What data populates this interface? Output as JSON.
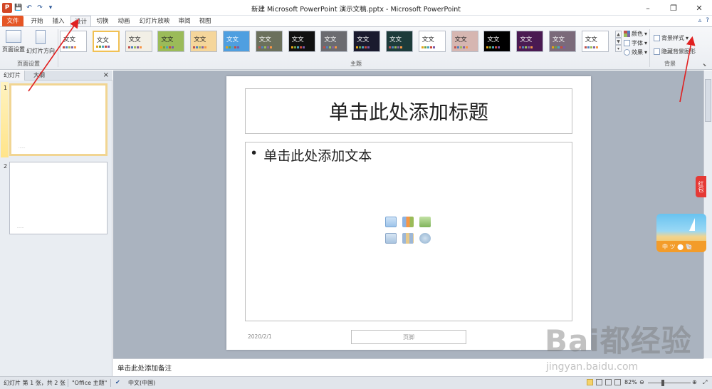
{
  "window": {
    "title": "新建 Microsoft PowerPoint 演示文稿.pptx - Microsoft PowerPoint",
    "app_letter": "P"
  },
  "tabs": [
    "文件",
    "开始",
    "插入",
    "设计",
    "切换",
    "动画",
    "幻灯片放映",
    "审阅",
    "视图"
  ],
  "active_tab": "设计",
  "ribbon": {
    "page_setup": {
      "btn1": "页面设置",
      "btn2": "幻灯片方向",
      "label": "页面设置"
    },
    "themes_label": "主题",
    "theme_sample_text": "文文",
    "theme_text_2": "文文",
    "theme_colors": [
      "#ffffff",
      "#ffffff",
      "#f2efe6",
      "#9bbb59",
      "#f5d69b",
      "#4f9fe0",
      "#6b705c",
      "#111111",
      "#6b6b70",
      "#1a1a2e",
      "#1d3b3a",
      "#ffffff",
      "#d6b6b1",
      "#000000",
      "#4a1a52",
      "#7b6a7a",
      "#ffffff"
    ],
    "colors_btn": "颜色",
    "fonts_btn": "字体",
    "effects_btn": "效果",
    "bg_styles_btn": "背景样式",
    "hide_bg_btn": "隐藏背景图形",
    "background_label": "背景"
  },
  "left_panel": {
    "tab_slides": "幻灯片",
    "tab_outline": "大纲",
    "close": "×",
    "slide_numbers": [
      "1",
      "2"
    ],
    "thumb_dots": "......"
  },
  "slide": {
    "title_placeholder": "单击此处添加标题",
    "bullet": "•",
    "content_placeholder": "单击此处添加文本",
    "date": "2020/2/1",
    "footer_placeholder": "页脚"
  },
  "notes_placeholder": "单击此处添加备注",
  "status": {
    "slide_info": "幻灯片 第 1 张，共 2 张",
    "theme": "\"Office 主题\"",
    "language": "中文(中国)",
    "zoom": "82%"
  },
  "overlays": {
    "red_badge": "红包",
    "beach_text": "中 ツ ⬤ 🐚",
    "watermark_big": "Bai都经验",
    "watermark_small": "jingyan.baidu.com"
  },
  "accent_colors": {
    "file_tab": "#e55525",
    "arrow": "#e02020"
  }
}
